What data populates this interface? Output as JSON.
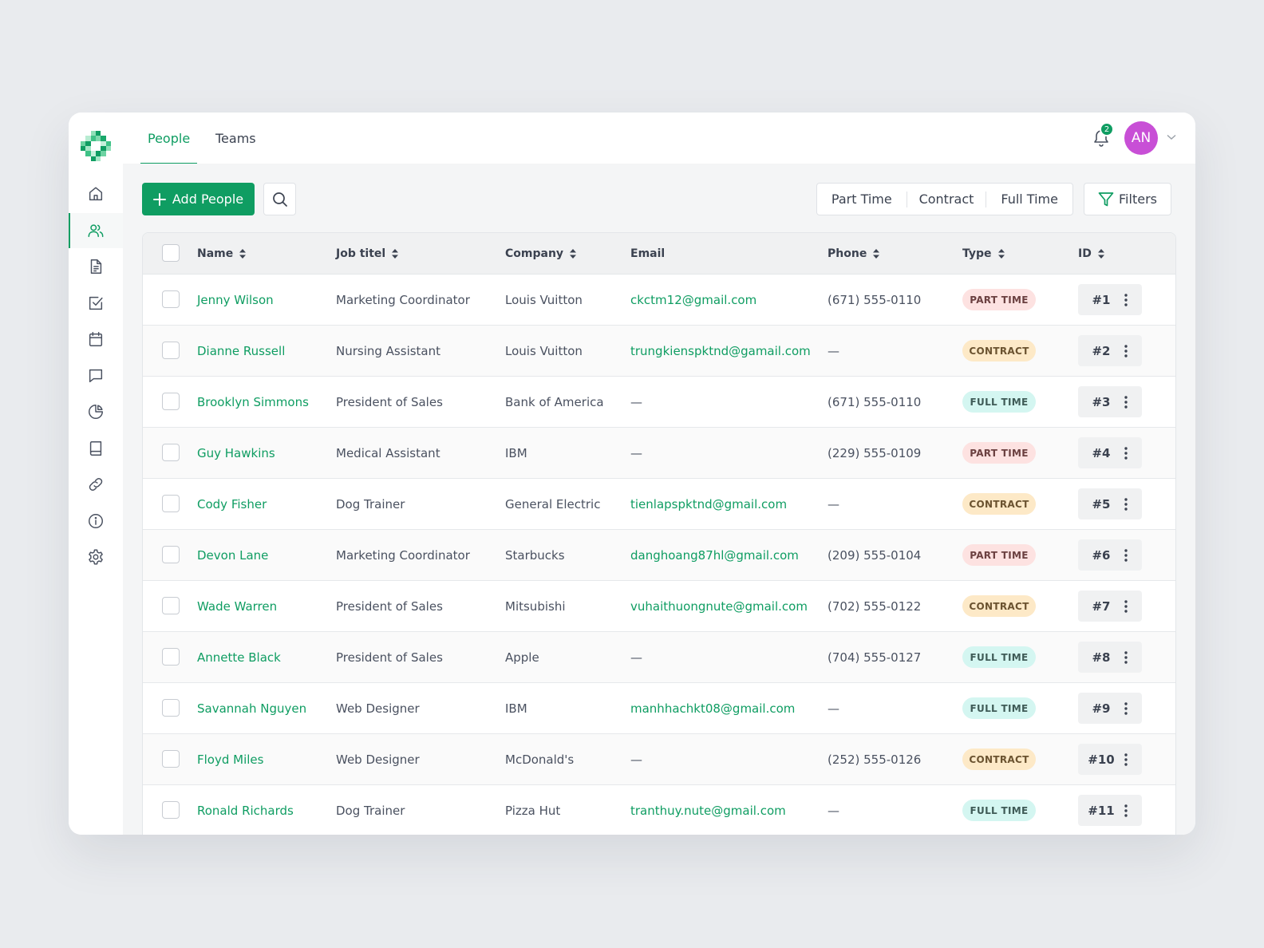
{
  "nav": {
    "tabs": [
      {
        "label": "People",
        "active": true
      },
      {
        "label": "Teams",
        "active": false
      }
    ]
  },
  "notifications": {
    "count": "2"
  },
  "user": {
    "initials": "AN",
    "color": "#c84fd6"
  },
  "sidebar": {
    "items": [
      {
        "icon": "home-icon",
        "active": false
      },
      {
        "icon": "users-icon",
        "active": true
      },
      {
        "icon": "document-icon",
        "active": false
      },
      {
        "icon": "checkbox-icon",
        "active": false
      },
      {
        "icon": "calendar-icon",
        "active": false
      },
      {
        "icon": "chat-icon",
        "active": false
      },
      {
        "icon": "pie-chart-icon",
        "active": false
      },
      {
        "icon": "book-icon",
        "active": false
      },
      {
        "icon": "link-icon",
        "active": false
      },
      {
        "icon": "info-icon",
        "active": false
      },
      {
        "icon": "settings-icon",
        "active": false
      }
    ]
  },
  "toolbar": {
    "add_label": "Add People",
    "segments": [
      "Part Time",
      "Contract",
      "Full Time"
    ],
    "filters_label": "Filters"
  },
  "colors": {
    "accent": "#0f9d62",
    "part_time": "#fde2e1",
    "contract": "#fde9c7",
    "full_time": "#d4f6f1"
  },
  "table": {
    "columns": [
      "Name",
      "Job titel",
      "Company",
      "Email",
      "Phone",
      "Type",
      "ID"
    ],
    "rows": [
      {
        "name": "Jenny Wilson",
        "job": "Marketing Coordinator",
        "company": "Louis Vuitton",
        "email": "ckctm12@gmail.com",
        "phone": "(671) 555-0110",
        "type": "PART TIME",
        "id": "#1"
      },
      {
        "name": "Dianne Russell",
        "job": "Nursing Assistant",
        "company": "Louis Vuitton",
        "email": "trungkienspktnd@gamail.com",
        "phone": "—",
        "type": "CONTRACT",
        "id": "#2"
      },
      {
        "name": "Brooklyn Simmons",
        "job": "President of Sales",
        "company": "Bank of America",
        "email": "—",
        "phone": "(671) 555-0110",
        "type": "FULL TIME",
        "id": "#3"
      },
      {
        "name": "Guy Hawkins",
        "job": "Medical Assistant",
        "company": "IBM",
        "email": "—",
        "phone": "(229) 555-0109",
        "type": "PART TIME",
        "id": "#4"
      },
      {
        "name": "Cody Fisher",
        "job": "Dog Trainer",
        "company": "General Electric",
        "email": "tienlapspktnd@gmail.com",
        "phone": "—",
        "type": "CONTRACT",
        "id": "#5"
      },
      {
        "name": "Devon Lane",
        "job": "Marketing Coordinator",
        "company": "Starbucks",
        "email": "danghoang87hl@gmail.com",
        "phone": "(209) 555-0104",
        "type": "PART TIME",
        "id": "#6"
      },
      {
        "name": "Wade Warren",
        "job": "President of Sales",
        "company": "Mitsubishi",
        "email": "vuhaithuongnute@gmail.com",
        "phone": "(702) 555-0122",
        "type": "CONTRACT",
        "id": "#7"
      },
      {
        "name": "Annette Black",
        "job": "President of Sales",
        "company": "Apple",
        "email": "—",
        "phone": "(704) 555-0127",
        "type": "FULL TIME",
        "id": "#8"
      },
      {
        "name": "Savannah Nguyen",
        "job": "Web Designer",
        "company": "IBM",
        "email": "manhhachkt08@gmail.com",
        "phone": "—",
        "type": "FULL TIME",
        "id": "#9"
      },
      {
        "name": "Floyd Miles",
        "job": "Web Designer",
        "company": "McDonald's",
        "email": "—",
        "phone": "(252) 555-0126",
        "type": "CONTRACT",
        "id": "#10"
      },
      {
        "name": "Ronald Richards",
        "job": "Dog Trainer",
        "company": "Pizza Hut",
        "email": "tranthuy.nute@gmail.com",
        "phone": "—",
        "type": "FULL TIME",
        "id": "#11"
      }
    ]
  }
}
